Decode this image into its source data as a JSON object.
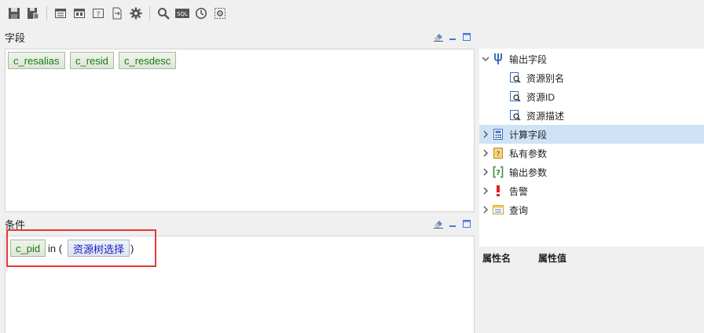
{
  "toolbar": {
    "icons": [
      "save-icon",
      "save-as-icon",
      "table-icon",
      "table-alt-icon",
      "parameter-icon",
      "export-icon",
      "gear-icon",
      "search-icon",
      "sql-icon",
      "clock-icon",
      "settings-frame-icon"
    ],
    "sql_label": "SQL"
  },
  "fields_section": {
    "title": "字段",
    "tokens": [
      "c_resalias",
      "c_resid",
      "c_resdesc"
    ]
  },
  "condition_section": {
    "title": "条件",
    "field_token": "c_pid",
    "operator": "in (",
    "value_token": "资源树选择",
    "close": ")"
  },
  "tree": {
    "items": [
      {
        "label": "输出字段",
        "expanded": true
      },
      {
        "label": "资源别名"
      },
      {
        "label": "资源ID"
      },
      {
        "label": "资源描述"
      },
      {
        "label": "计算字段",
        "selected": true
      },
      {
        "label": "私有参数"
      },
      {
        "label": "输出参数"
      },
      {
        "label": "告警"
      },
      {
        "label": "查询"
      }
    ]
  },
  "properties": {
    "col_name": "属性名",
    "col_value": "属性值"
  },
  "colors": {
    "token_green": "#1a7a1a",
    "token_blue": "#1a1acc",
    "selected_row": "#cfe3f7",
    "highlight": "#e53935"
  }
}
